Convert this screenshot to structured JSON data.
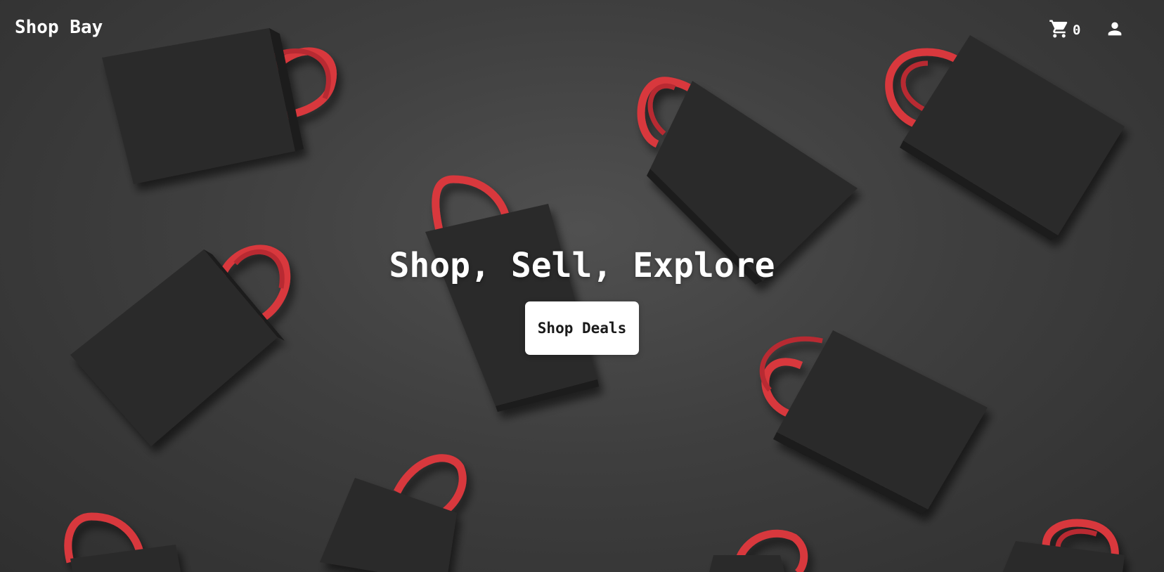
{
  "navbar": {
    "brand": "Shop Bay",
    "cart_icon": "shopping-cart-icon",
    "cart_count": "0",
    "user_icon": "user-account-icon"
  },
  "hero": {
    "headline": "Shop, Sell, Explore",
    "cta_label": "Shop Deals",
    "background_image": "black shopping bags with red handles on dark gray surface"
  },
  "colors": {
    "background": "#3f3f3f",
    "bag": "#2a2a2a",
    "handle": "#d8383c",
    "text": "#ffffff",
    "button_bg": "#ffffff",
    "button_text": "#1a1a1a"
  }
}
